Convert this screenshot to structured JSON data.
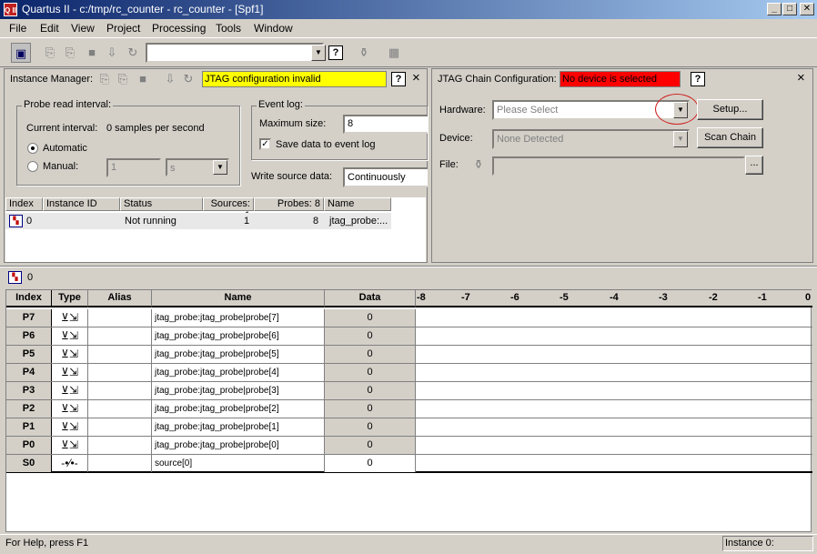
{
  "window": {
    "title": "Quartus II - c:/tmp/rc_counter - rc_counter - [Spf1]",
    "app_icon": "Q II"
  },
  "window_buttons": {
    "minimize": "_",
    "maximize": "□",
    "close": "✕"
  },
  "menu": [
    "File",
    "Edit",
    "View",
    "Project",
    "Processing",
    "Tools",
    "Window"
  ],
  "toolbar": {
    "combo_value": "",
    "help_label": "?"
  },
  "instance_manager": {
    "label": "Instance Manager:",
    "status": "JTAG configuration invalid",
    "status_color": "#ffff00",
    "help_label": "?",
    "close_label": "×",
    "probe_group": {
      "title": "Probe read interval:",
      "current_label": "Current interval:",
      "current_value": "0 samples per second",
      "automatic_label": "Automatic",
      "manual_label": "Manual:",
      "manual_value": "1",
      "manual_unit": "s"
    },
    "event_log": {
      "title": "Event log:",
      "max_size_label": "Maximum size:",
      "max_size_value": "8",
      "save_label": "Save data to event log",
      "save_checked": true
    },
    "write_source_label": "Write source data:",
    "write_source_value": "Continuously",
    "table": {
      "headers": [
        "Index",
        "Instance ID",
        "Status",
        "Sources: 1",
        "Probes: 8",
        "Name"
      ],
      "rows": [
        {
          "index": "0",
          "instance_id": "",
          "status": "Not running",
          "sources": "1",
          "probes": "8",
          "name": "jtag_probe:..."
        }
      ]
    }
  },
  "jtag_chain": {
    "label": "JTAG Chain Configuration:",
    "status": "No device is selected",
    "status_color": "#ff0000",
    "help_label": "?",
    "close_label": "×",
    "hardware_label": "Hardware:",
    "hardware_value": "Please Select",
    "setup_label": "Setup...",
    "device_label": "Device:",
    "device_value": "None Detected",
    "scan_label": "Scan Chain",
    "file_label": "File:",
    "file_value": "",
    "browse_label": "..."
  },
  "signal_view": {
    "instance_label": "0",
    "headers": {
      "index": "Index",
      "type": "Type",
      "alias": "Alias",
      "name": "Name",
      "data": "Data"
    },
    "time_ticks": [
      "-8",
      "-7",
      "-6",
      "-5",
      "-4",
      "-3",
      "-2",
      "-1",
      "0"
    ],
    "rows": [
      {
        "index": "P7",
        "type": "probe",
        "type_glyph": "⊻⇲",
        "alias": "",
        "name": "jtag_probe:jtag_probe|probe[7]",
        "data": "0"
      },
      {
        "index": "P6",
        "type": "probe",
        "type_glyph": "⊻⇲",
        "alias": "",
        "name": "jtag_probe:jtag_probe|probe[6]",
        "data": "0"
      },
      {
        "index": "P5",
        "type": "probe",
        "type_glyph": "⊻⇲",
        "alias": "",
        "name": "jtag_probe:jtag_probe|probe[5]",
        "data": "0"
      },
      {
        "index": "P4",
        "type": "probe",
        "type_glyph": "⊻⇲",
        "alias": "",
        "name": "jtag_probe:jtag_probe|probe[4]",
        "data": "0"
      },
      {
        "index": "P3",
        "type": "probe",
        "type_glyph": "⊻⇲",
        "alias": "",
        "name": "jtag_probe:jtag_probe|probe[3]",
        "data": "0"
      },
      {
        "index": "P2",
        "type": "probe",
        "type_glyph": "⊻⇲",
        "alias": "",
        "name": "jtag_probe:jtag_probe|probe[2]",
        "data": "0"
      },
      {
        "index": "P1",
        "type": "probe",
        "type_glyph": "⊻⇲",
        "alias": "",
        "name": "jtag_probe:jtag_probe|probe[1]",
        "data": "0"
      },
      {
        "index": "P0",
        "type": "probe",
        "type_glyph": "⊻⇲",
        "alias": "",
        "name": "jtag_probe:jtag_probe|probe[0]",
        "data": "0"
      },
      {
        "index": "S0",
        "type": "source",
        "type_glyph": "-•⁄•-",
        "alias": "",
        "name": "source[0]",
        "data": "0"
      }
    ]
  },
  "statusbar": {
    "help_text": "For Help, press F1",
    "instance_text": "Instance 0:"
  }
}
